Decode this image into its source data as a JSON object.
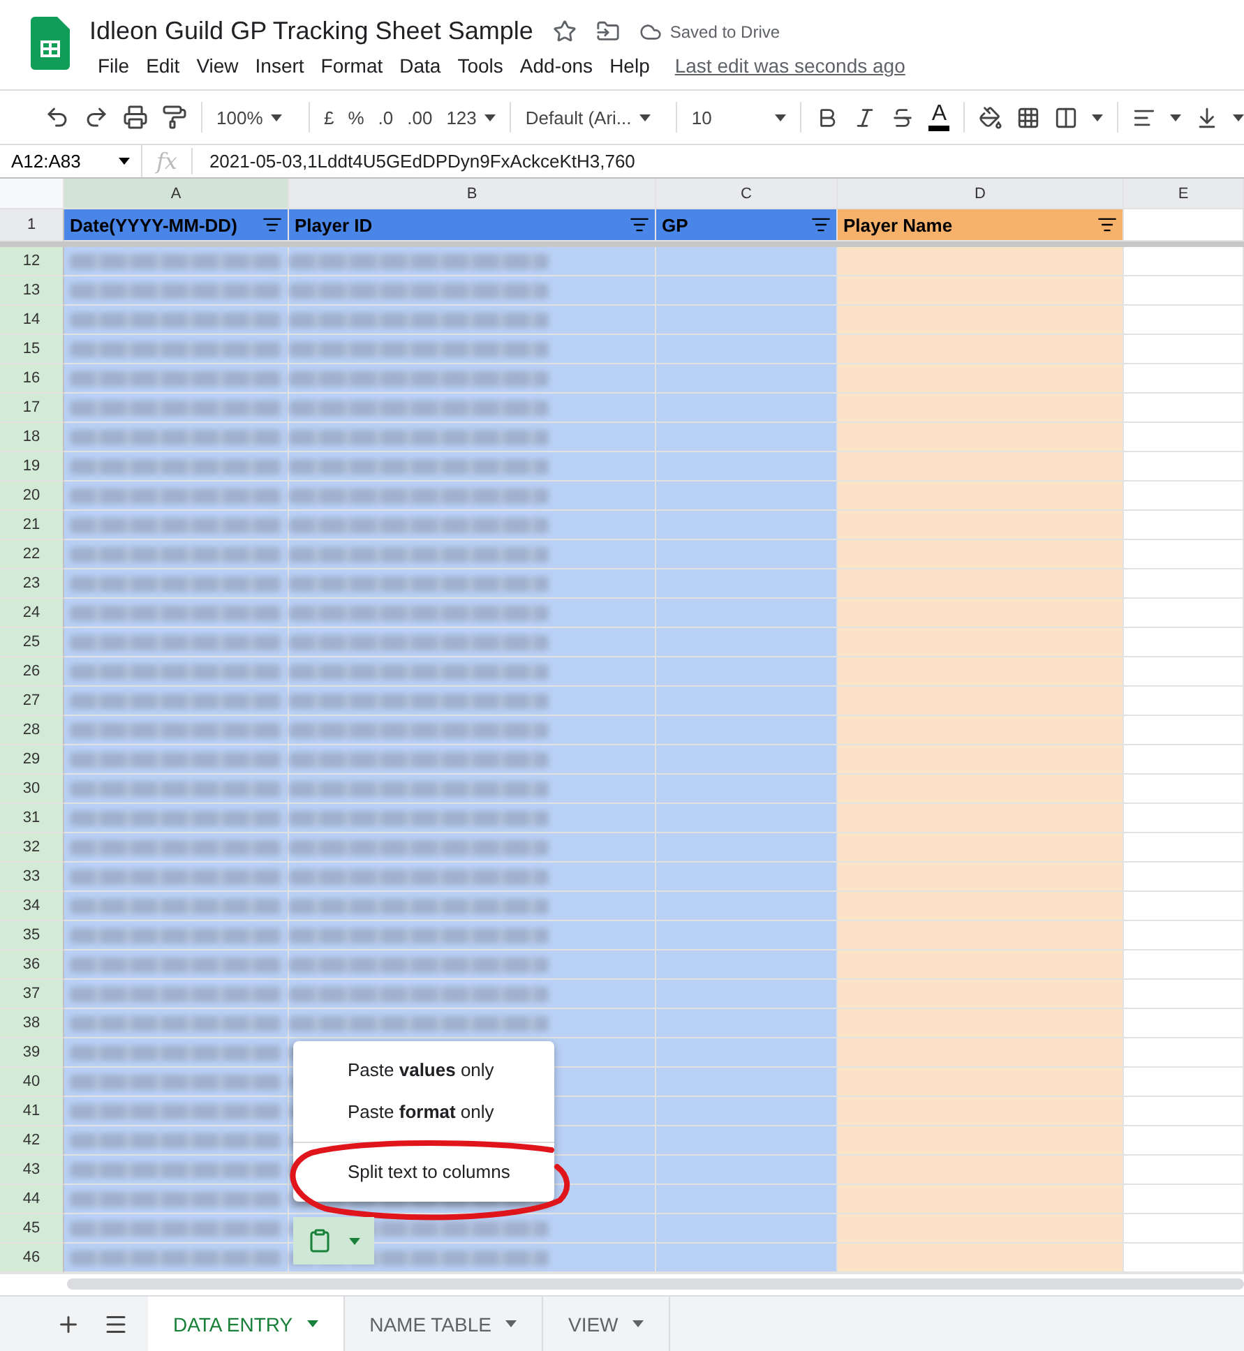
{
  "document": {
    "title": "Idleon Guild GP Tracking Sheet Sample",
    "status": "Saved to Drive",
    "last_edit": "Last edit was seconds ago"
  },
  "menu": [
    "File",
    "Edit",
    "View",
    "Insert",
    "Format",
    "Data",
    "Tools",
    "Add-ons",
    "Help"
  ],
  "toolbar": {
    "zoom": "100%",
    "currency": "£",
    "percent": "%",
    "decrease_decimal": ".0",
    "increase_decimal": ".00",
    "more_formats": "123",
    "font": "Default (Ari...",
    "font_size": "10",
    "text_color": "A"
  },
  "formula_bar": {
    "name_box": "A12:A83",
    "fx": "fx",
    "formula": "2021-05-03,1Lddt4U5GEdDPDyn9FxAckceKtH3,760"
  },
  "column_letters": [
    "A",
    "B",
    "C",
    "D",
    "E"
  ],
  "header_row": {
    "number": "1",
    "cells": [
      {
        "text": "Date(YYYY-MM-DD)",
        "color": "#4a86e8"
      },
      {
        "text": "Player ID",
        "color": "#4a86e8"
      },
      {
        "text": "GP",
        "color": "#4a86e8"
      },
      {
        "text": "Player Name",
        "color": "#f6b26b"
      }
    ]
  },
  "rows": [
    "12",
    "13",
    "14",
    "15",
    "16",
    "17",
    "18",
    "19",
    "20",
    "21",
    "22",
    "23",
    "24",
    "25",
    "26",
    "27",
    "28",
    "29",
    "30",
    "31",
    "32",
    "33",
    "34",
    "35",
    "36",
    "37",
    "38",
    "39",
    "40",
    "41",
    "42",
    "43",
    "44",
    "45",
    "46"
  ],
  "paste_menu": {
    "groups": [
      [
        {
          "text": "Paste **values** only",
          "circled": false
        },
        {
          "text": "Paste **format** only",
          "circled": false
        }
      ],
      [
        {
          "text": "Split text to columns",
          "circled": true
        }
      ]
    ]
  },
  "sheet_tabs": [
    {
      "label": "DATA ENTRY",
      "selected": true
    },
    {
      "label": "NAME TABLE",
      "selected": false
    },
    {
      "label": "VIEW",
      "selected": false
    }
  ]
}
